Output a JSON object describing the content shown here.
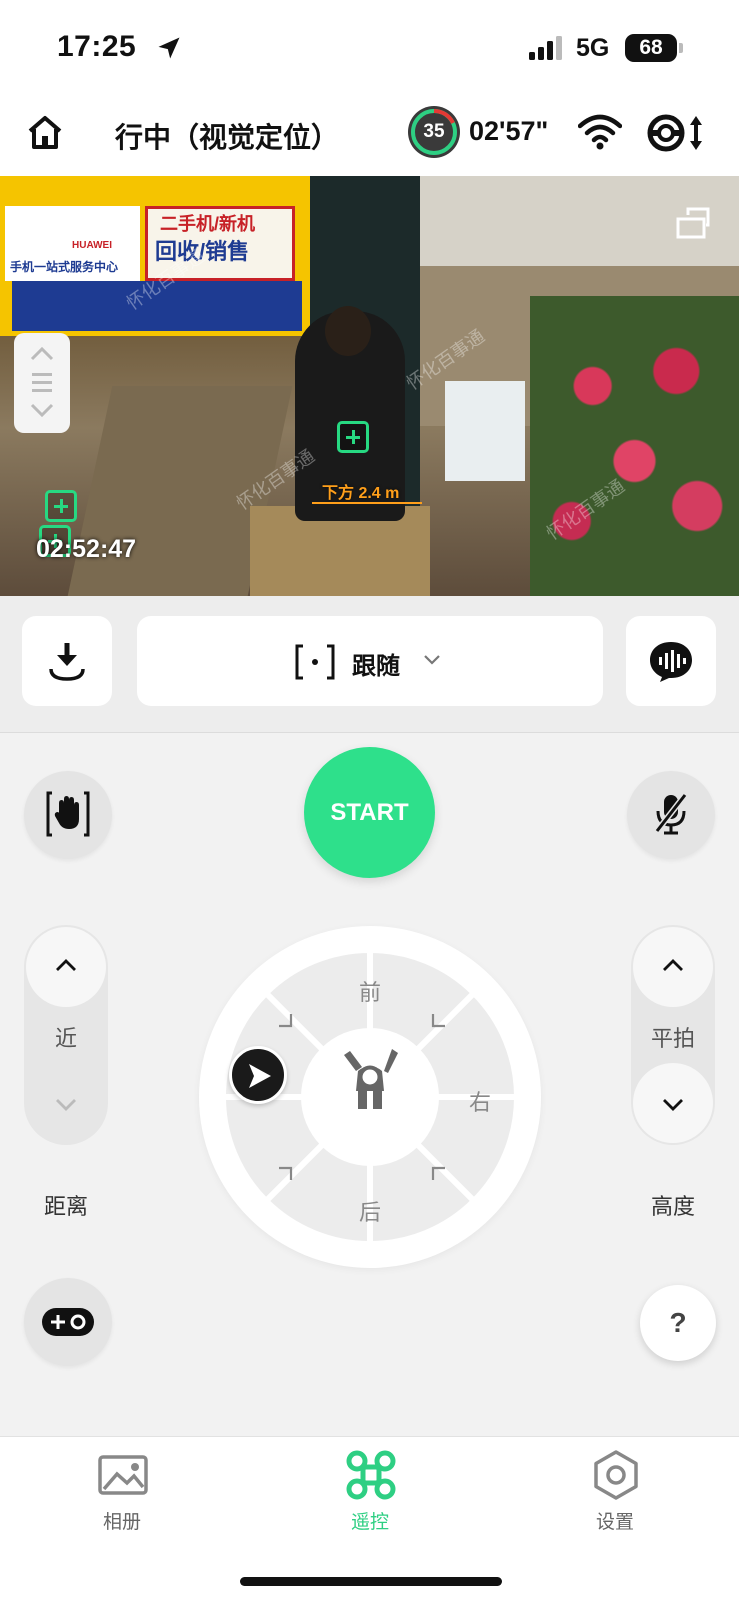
{
  "status_bar": {
    "time": "17:25",
    "network": "5G",
    "battery": "68"
  },
  "header": {
    "title": "行中（视觉定位）",
    "drone_battery": "35",
    "flight_time": "02'57\""
  },
  "camera": {
    "depth_label": "下方 2.4 m",
    "record_time": "02:52:47",
    "sign_text_1": "二手机/新机",
    "sign_text_2": "回收/销售",
    "sign_text_3": "手机一站式服务中心",
    "sign_text_4": "HUAWEI",
    "watermark": "怀化百事通"
  },
  "toolbar": {
    "mode_label": "跟随"
  },
  "control": {
    "start_label": "START",
    "distance": {
      "label": "近",
      "caption": "距离"
    },
    "height": {
      "label": "平拍",
      "caption": "高度"
    },
    "dpad": {
      "front": "前",
      "back": "后",
      "right": "右"
    },
    "help": "?"
  },
  "tabs": [
    {
      "label": "相册",
      "icon": "album-icon"
    },
    {
      "label": "遥控",
      "icon": "drone-icon"
    },
    {
      "label": "设置",
      "icon": "settings-icon"
    }
  ],
  "colors": {
    "accent": "#2ee08b",
    "warning": "#ff9f1a",
    "battery_ring": "#2ecf83",
    "battery_low": "#e53935"
  }
}
